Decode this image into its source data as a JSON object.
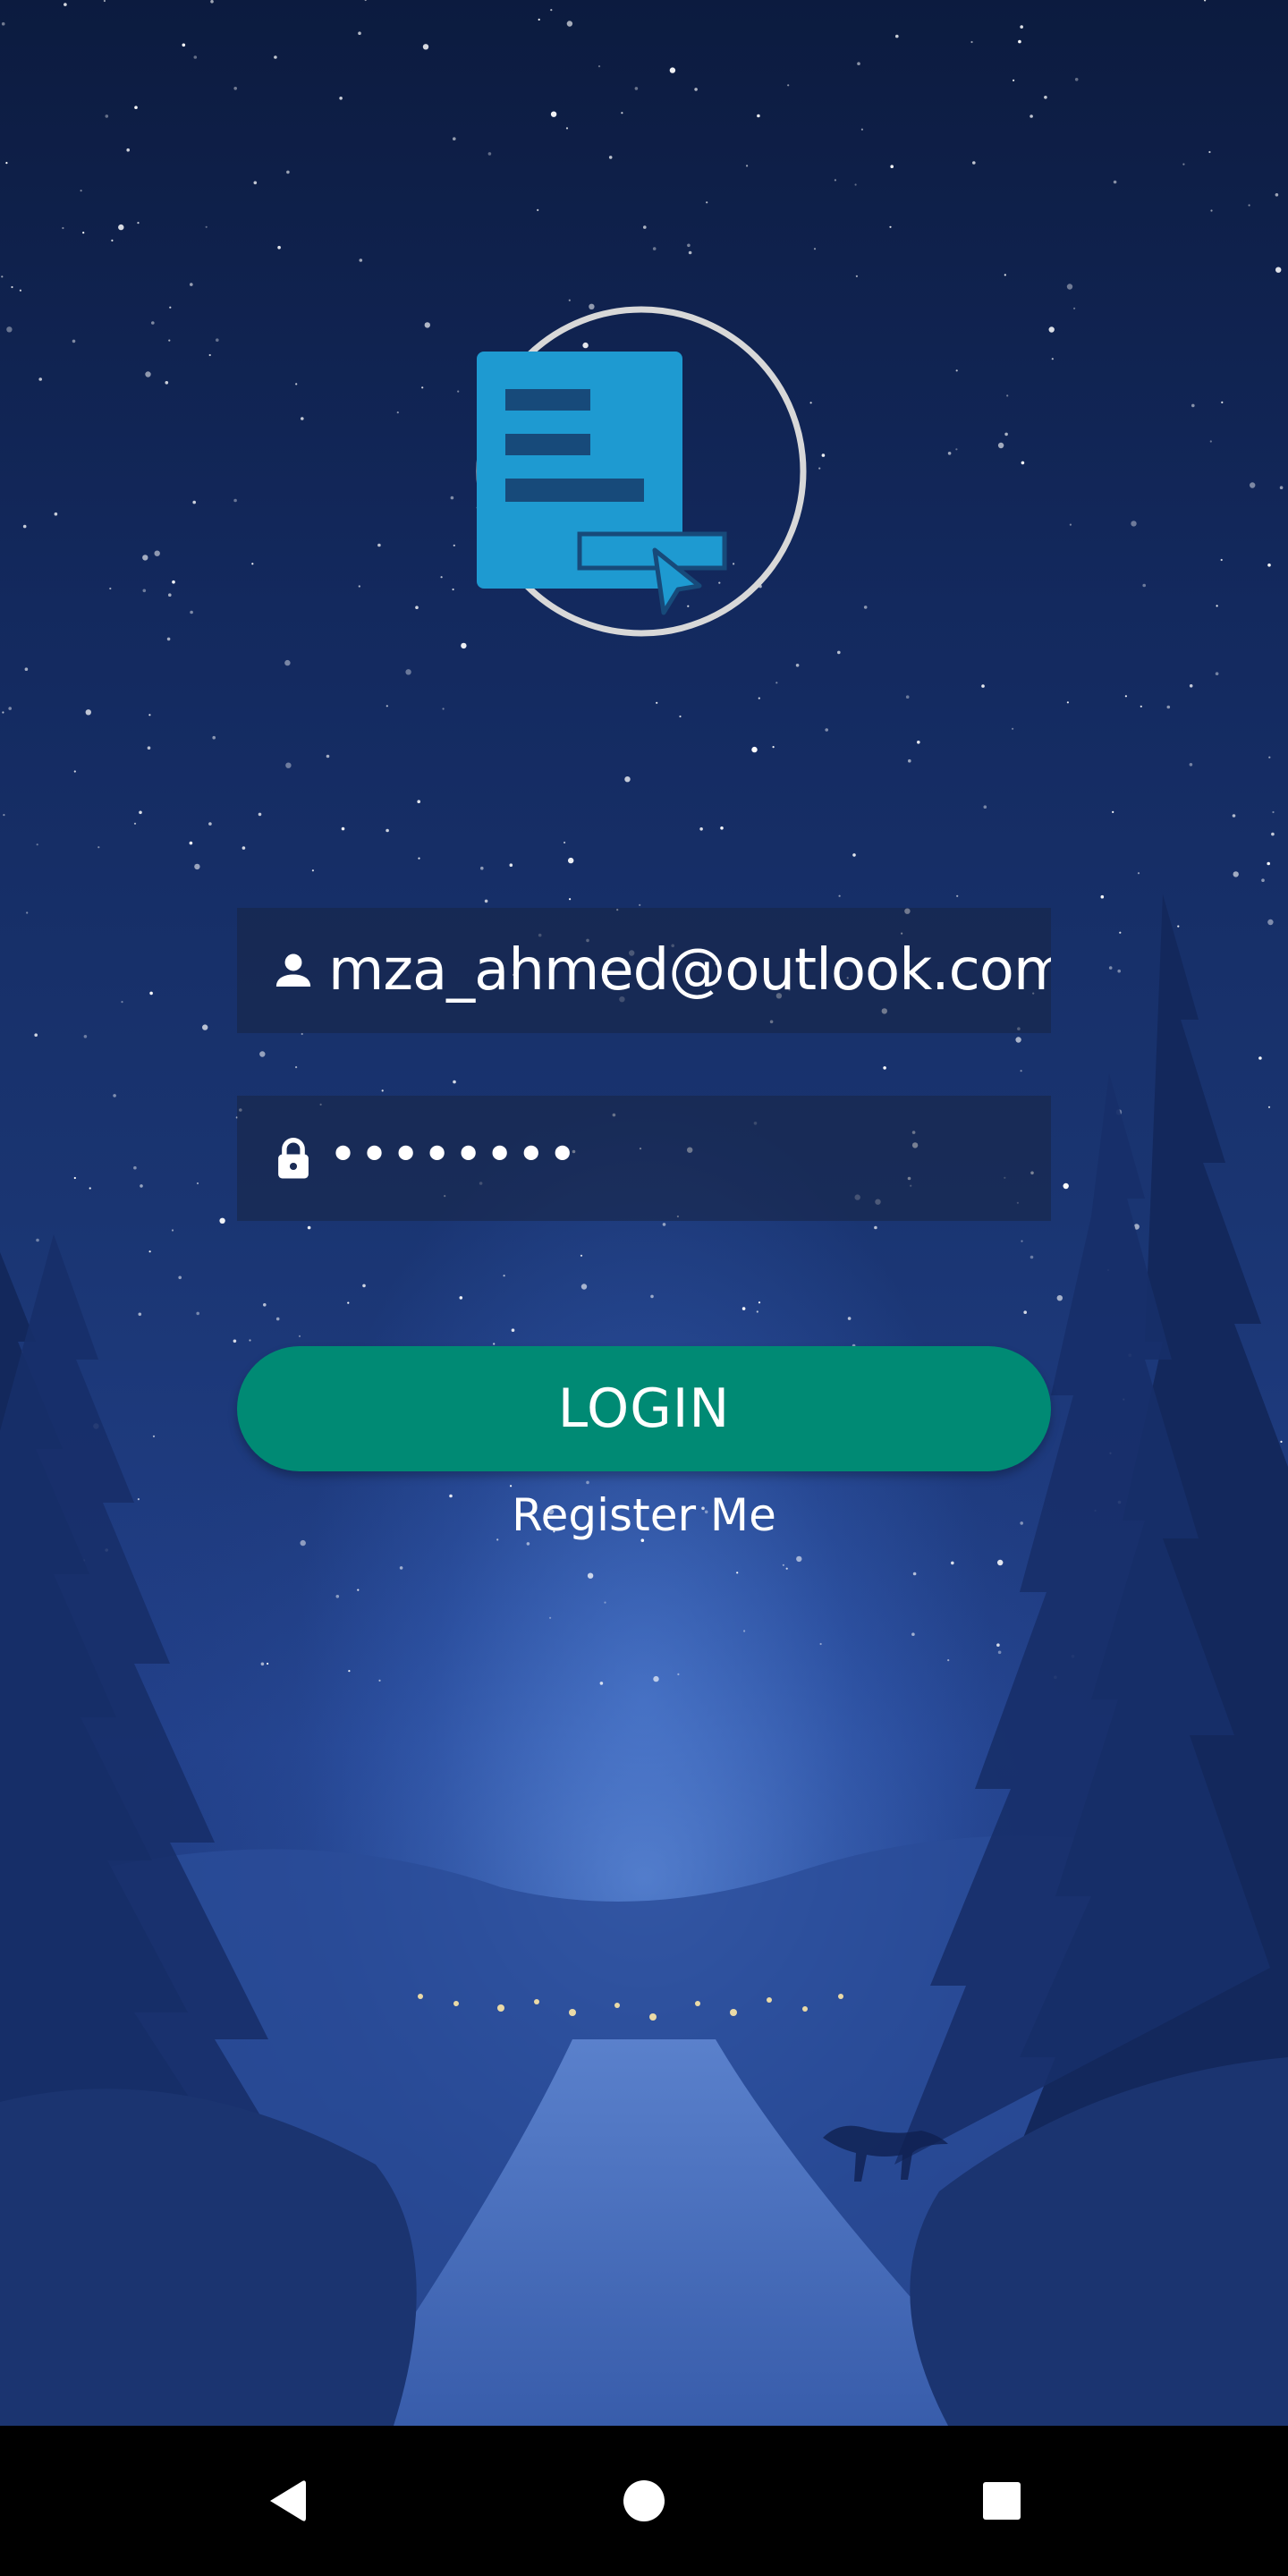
{
  "app": {
    "logo_icon": "form-cursor-logo-icon",
    "accent_color": "#008a74",
    "logo_color": "#1e9ad1"
  },
  "login_form": {
    "email_icon": "person-icon",
    "email_value": "mza_ahmed@outlook.com",
    "password_icon": "lock-icon",
    "password_value": "••••••••",
    "login_label": "LOGIN",
    "register_label": "Register Me"
  },
  "navigation_bar": {
    "back_icon": "back-triangle-icon",
    "home_icon": "home-circle-icon",
    "recents_icon": "recents-square-icon"
  }
}
